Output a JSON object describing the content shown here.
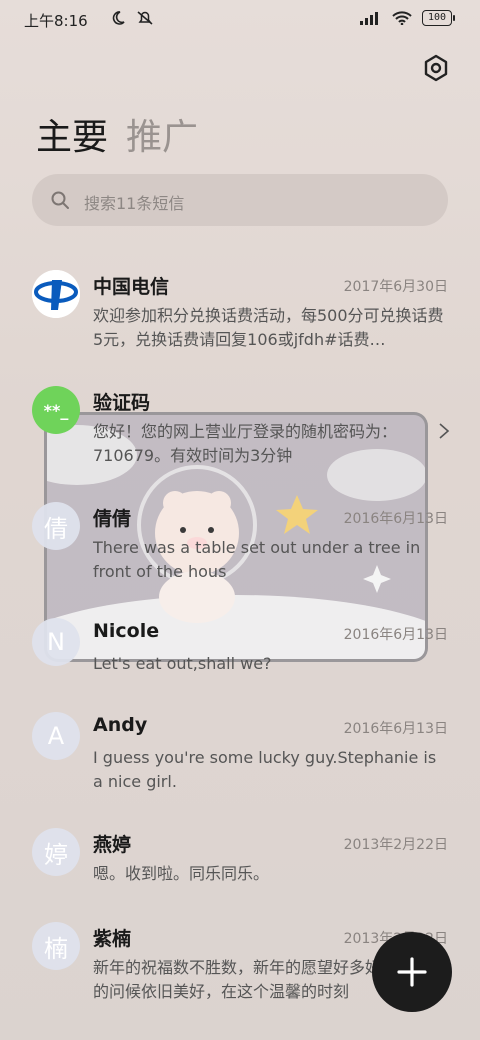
{
  "status_bar": {
    "time": "上午8:16",
    "battery": "100"
  },
  "tabs": {
    "main": "主要",
    "promotions": "推广"
  },
  "search": {
    "placeholder": "搜索11条短信"
  },
  "messages": [
    {
      "avatar_text": "",
      "name": "中国电信",
      "date": "2017年6月30日",
      "preview": "欢迎参加积分兑换话费活动，每500分可兑换话费5元，兑换话费请回复106或jfdh#话费…"
    },
    {
      "avatar_text": "**_",
      "name": "验证码",
      "date": "",
      "preview": "您好！您的网上营业厅登录的随机密码为：710679。有效时间为3分钟"
    },
    {
      "avatar_text": "倩",
      "name": "倩倩",
      "date": "2016年6月13日",
      "preview": "There was a table set out under a tree in front of the hous"
    },
    {
      "avatar_text": "N",
      "name": "Nicole",
      "date": "2016年6月13日",
      "preview": "Let's eat out,shall we?"
    },
    {
      "avatar_text": "A",
      "name": "Andy",
      "date": "2016年6月13日",
      "preview": "I guess you're some lucky guy.Stephanie is a nice girl."
    },
    {
      "avatar_text": "婷",
      "name": "燕婷",
      "date": "2013年2月22日",
      "preview": "嗯。收到啦。同乐同乐。"
    },
    {
      "avatar_text": "楠",
      "name": "紫楠",
      "date": "2013年2月22日",
      "preview": "新年的祝福数不胜数，新年的愿望好多好多，新年的问候依旧美好，在这个温馨的时刻"
    }
  ],
  "colors": {
    "verify_avatar": "#6fd35a",
    "telecom_blue": "#0a5bbd",
    "fab": "#1c1c1c"
  },
  "icons": {
    "settings": "hexagon-settings-icon",
    "search": "search-icon",
    "fab": "plus-icon"
  }
}
